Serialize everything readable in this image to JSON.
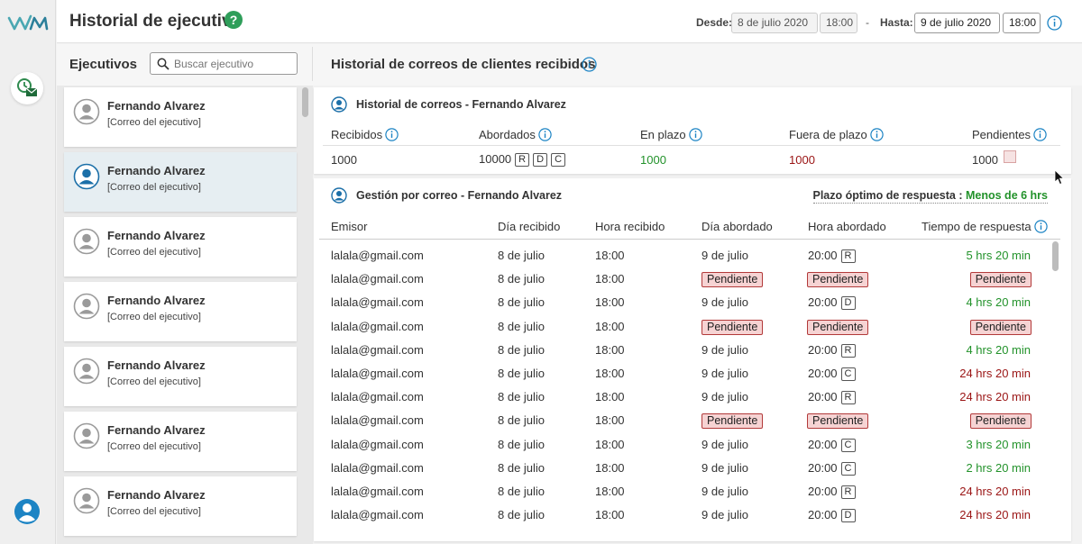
{
  "header": {
    "title": "Historial de ejecutivo",
    "from_label": "Desde:",
    "from_date": "8 de julio 2020",
    "from_time": "18:00",
    "dash": "-",
    "to_label": "Hasta:",
    "to_date": "9 de julio 2020",
    "to_time": "18:00"
  },
  "sidebar": {
    "title": "Ejecutivos",
    "search_placeholder": "Buscar ejecutivo",
    "executives": [
      {
        "name": "Fernando Alvarez",
        "email": "[Correo del ejecutivo]",
        "selected": false
      },
      {
        "name": "Fernando Alvarez",
        "email": "[Correo del ejecutivo]",
        "selected": true
      },
      {
        "name": "Fernando Alvarez",
        "email": "[Correo del ejecutivo]",
        "selected": false
      },
      {
        "name": "Fernando Alvarez",
        "email": "[Correo del ejecutivo]",
        "selected": false
      },
      {
        "name": "Fernando Alvarez",
        "email": "[Correo del ejecutivo]",
        "selected": false
      },
      {
        "name": "Fernando Alvarez",
        "email": "[Correo del ejecutivo]",
        "selected": false
      },
      {
        "name": "Fernando Alvarez",
        "email": "[Correo del ejecutivo]",
        "selected": false
      }
    ]
  },
  "main": {
    "title": "Historial de correos de clientes recibidos",
    "summary": {
      "title": "Historial de correos - Fernando Alvarez",
      "col_received": "Recibidos",
      "col_handled": "Abordados",
      "col_on_time": "En plazo",
      "col_late": "Fuera de plazo",
      "col_pending": "Pendientes",
      "received": "1000",
      "handled": "10000",
      "handled_badges": [
        "R",
        "D",
        "C"
      ],
      "on_time": "1000",
      "late": "1000",
      "pending": "1000"
    },
    "detail": {
      "title": "Gestión por correo - Fernando Alvarez",
      "optimal_label": "Plazo óptimo de respuesta :",
      "optimal_value": "Menos de 6 hrs",
      "headers": [
        "Emisor",
        "Día recibido",
        "Hora recibido",
        "Día abordado",
        "Hora abordado",
        "Tiempo de respuesta"
      ],
      "rows": [
        {
          "sender": "lalala@gmail.com",
          "day_rec": "8 de julio",
          "hour_rec": "18:00",
          "day_hand": "9 de julio",
          "hour_hand": "20:00",
          "badge": "R",
          "time": "5 hrs 20 min",
          "status": "green"
        },
        {
          "sender": "lalala@gmail.com",
          "day_rec": "8 de julio",
          "hour_rec": "18:00",
          "day_hand": "Pendiente",
          "hour_hand": "Pendiente",
          "badge": "",
          "time": "Pendiente",
          "status": "pending"
        },
        {
          "sender": "lalala@gmail.com",
          "day_rec": "8 de julio",
          "hour_rec": "18:00",
          "day_hand": "9 de julio",
          "hour_hand": "20:00",
          "badge": "D",
          "time": "4 hrs 20 min",
          "status": "green"
        },
        {
          "sender": "lalala@gmail.com",
          "day_rec": "8 de julio",
          "hour_rec": "18:00",
          "day_hand": "Pendiente",
          "hour_hand": "Pendiente",
          "badge": "",
          "time": "Pendiente",
          "status": "pending"
        },
        {
          "sender": "lalala@gmail.com",
          "day_rec": "8 de julio",
          "hour_rec": "18:00",
          "day_hand": "9 de julio",
          "hour_hand": "20:00",
          "badge": "R",
          "time": "4 hrs 20 min",
          "status": "green"
        },
        {
          "sender": "lalala@gmail.com",
          "day_rec": "8 de julio",
          "hour_rec": "18:00",
          "day_hand": "9 de julio",
          "hour_hand": "20:00",
          "badge": "C",
          "time": "24 hrs 20 min",
          "status": "red"
        },
        {
          "sender": "lalala@gmail.com",
          "day_rec": "8 de julio",
          "hour_rec": "18:00",
          "day_hand": "9 de julio",
          "hour_hand": "20:00",
          "badge": "R",
          "time": "24 hrs 20 min",
          "status": "red"
        },
        {
          "sender": "lalala@gmail.com",
          "day_rec": "8 de julio",
          "hour_rec": "18:00",
          "day_hand": "Pendiente",
          "hour_hand": "Pendiente",
          "badge": "",
          "time": "Pendiente",
          "status": "pending"
        },
        {
          "sender": "lalala@gmail.com",
          "day_rec": "8 de julio",
          "hour_rec": "18:00",
          "day_hand": "9 de julio",
          "hour_hand": "20:00",
          "badge": "C",
          "time": "3 hrs 20 min",
          "status": "green"
        },
        {
          "sender": "lalala@gmail.com",
          "day_rec": "8 de julio",
          "hour_rec": "18:00",
          "day_hand": "9 de julio",
          "hour_hand": "20:00",
          "badge": "C",
          "time": "2 hrs 20 min",
          "status": "green"
        },
        {
          "sender": "lalala@gmail.com",
          "day_rec": "8 de julio",
          "hour_rec": "18:00",
          "day_hand": "9 de julio",
          "hour_hand": "20:00",
          "badge": "R",
          "time": "24 hrs 20 min",
          "status": "red"
        },
        {
          "sender": "lalala@gmail.com",
          "day_rec": "8 de julio",
          "hour_rec": "18:00",
          "day_hand": "9 de julio",
          "hour_hand": "20:00",
          "badge": "D",
          "time": "24 hrs 20 min",
          "status": "red"
        }
      ]
    }
  },
  "colors": {
    "accent": "#1b6fa8",
    "green": "#22922a",
    "red": "#9a1414",
    "pending_bg": "#f6d3d3",
    "pending_border": "#b23a3a"
  },
  "icons": [
    "wm-logo-icon",
    "clock-mail-icon",
    "user-avatar-icon",
    "help-icon",
    "info-icon",
    "search-icon",
    "user-icon",
    "cursor-icon"
  ]
}
